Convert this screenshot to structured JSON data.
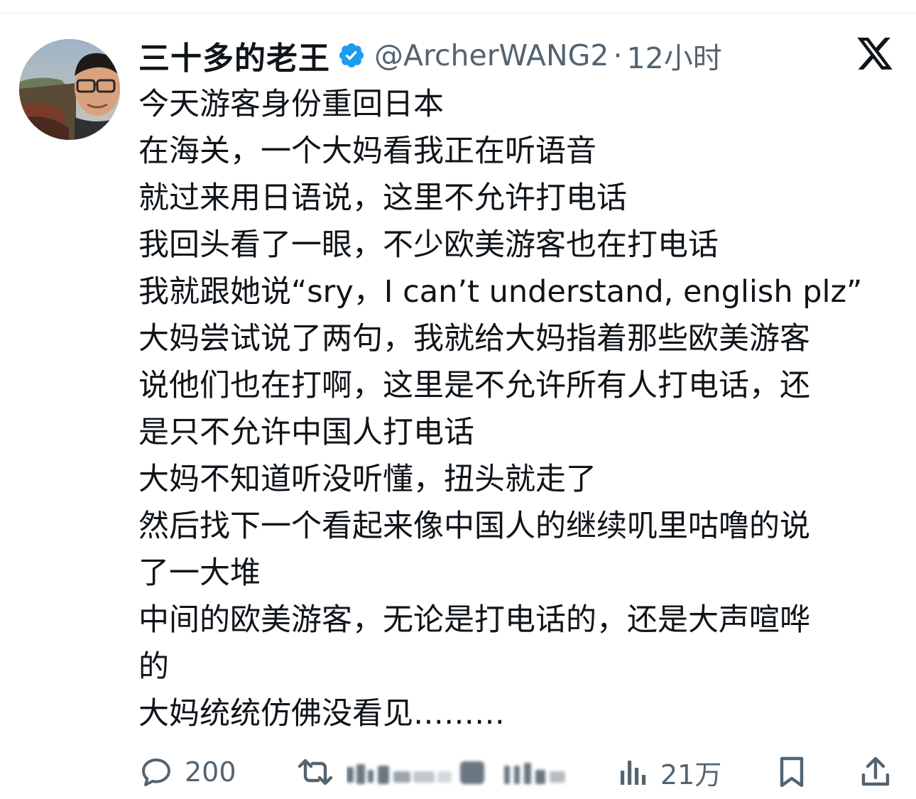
{
  "author": {
    "display_name": "三十多的老王",
    "handle": "@ArcherWANG2",
    "separator": "·",
    "time": "12小时",
    "verified": true
  },
  "tweet": {
    "lines": [
      "今天游客身份重回日本",
      "在海关，一个大妈看我正在听语音",
      "就过来用日语说，这里不允许打电话",
      "我回头看了一眼，不少欧美游客也在打电话",
      "我就跟她说“sry，I can’t understand, english plz”",
      "大妈尝试说了两句，我就给大妈指着那些欧美游客",
      "说他们也在打啊，这里是不允许所有人打电话，还",
      "是只不允许中国人打电话",
      "大妈不知道听没听懂，扭头就走了",
      "然后找下一个看起来像中国人的继续叽里咕噜的说",
      "了一大堆",
      "中间的欧美游客，无论是打电话的，还是大声喧哗",
      "的",
      "大妈统统仿佛没看见………"
    ]
  },
  "actions": {
    "replies": "200",
    "views": "21万"
  },
  "icons": {
    "verified": "verified-badge-icon",
    "logo": "x-logo-icon",
    "reply": "reply-bubble-icon",
    "repost": "repost-icon",
    "views": "views-bar-icon",
    "bookmark": "bookmark-icon",
    "share": "share-icon"
  },
  "colors": {
    "text": "#0f1419",
    "secondary": "#536471",
    "verified": "#1d9bf0"
  }
}
